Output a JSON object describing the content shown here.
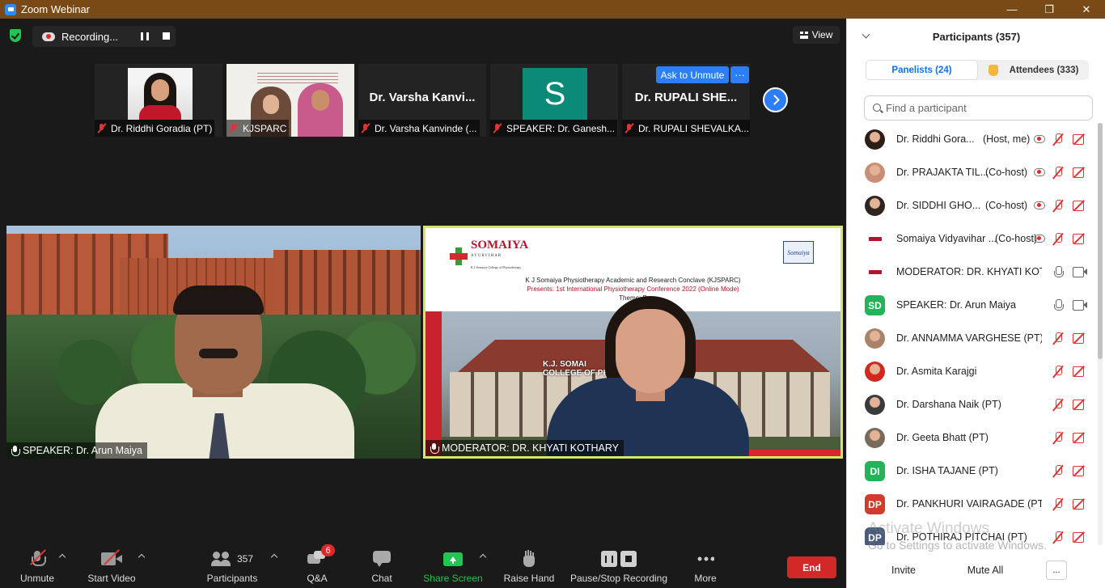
{
  "window": {
    "title": "Zoom Webinar",
    "controls": [
      "—",
      "❐",
      "✕"
    ]
  },
  "top": {
    "recording_label": "Recording...",
    "view_label": "View"
  },
  "thumbnails": [
    {
      "label": "Dr. Riddhi Goradia (PT)",
      "name": "",
      "kind": "photo"
    },
    {
      "label": "KJSPARC",
      "name": "",
      "kind": "slide"
    },
    {
      "label": "Dr. Varsha Kanvinde (...",
      "name": "Dr. Varsha Kanvi...",
      "kind": "name"
    },
    {
      "label": "SPEAKER: Dr. Ganesh...",
      "name": "",
      "avatar_letter": "S",
      "kind": "avatar"
    },
    {
      "label": "Dr. RUPALI SHEVALKA...",
      "name": "Dr. RUPALI SHE...",
      "kind": "name"
    }
  ],
  "ask_to_unmute": "Ask to Unmute",
  "thumb_more": "···",
  "main_videos": {
    "left_label": "SPEAKER: Dr. Arun Maiya",
    "right_label": "MODERATOR: DR. KHYATI KOTHARY"
  },
  "slide": {
    "logo_text": "SOMAIYA",
    "logo_sub": "AYURVIHAR",
    "logo_sub2": "K J Somaiya College of Physiotherapy",
    "trust_logo": "Somaiya",
    "line1": "K J Somaiya Physiotherapy Academic and Research Conclave (KJSPARC)",
    "line2": "Presents: 1st International  Physiotherapy Conference 2022 (Online Mode)",
    "line3": "Theme: B",
    "building_sign": "K.J. SOMAI\nCOLLEGE OF PHYSIO"
  },
  "toolbar": {
    "unmute": "Unmute",
    "start_video": "Start Video",
    "participants_count": "357",
    "participants": "Participants",
    "qa": "Q&A",
    "qa_badge": "6",
    "chat": "Chat",
    "share_screen": "Share Screen",
    "raise_hand": "Raise Hand",
    "pause_stop_recording": "Pause/Stop Recording",
    "more": "More",
    "end": "End"
  },
  "panel": {
    "title": "Participants (357)",
    "tabs": {
      "panelists": "Panelists (24)",
      "attendees": "Attendees (333)"
    },
    "search_placeholder": "Find a participant",
    "participants": [
      {
        "name": "Dr. Riddhi Gora...",
        "role": "(Host, me)",
        "avatar": "photo",
        "color": "#2b1d18",
        "rec": true,
        "mic": "muted",
        "video": "muted"
      },
      {
        "name": "Dr. PRAJAKTA TIL...",
        "role": "(Co-host)",
        "avatar": "photo",
        "color": "#c98f76",
        "rec": true,
        "mic": "muted",
        "video": "muted"
      },
      {
        "name": "Dr. SIDDHI GHO...",
        "role": "(Co-host)",
        "avatar": "photo",
        "color": "#2e2420",
        "rec": true,
        "mic": "muted",
        "video": "muted"
      },
      {
        "name": "Somaiya Vidyavihar ...",
        "role": "(Co-host)",
        "avatar": "logo",
        "color": "#b5122b",
        "rec": true,
        "mic": "muted",
        "video": "muted"
      },
      {
        "name": "MODERATOR: DR. KHYATI KOT...",
        "role": "",
        "avatar": "logo",
        "color": "#b5122b",
        "rec": false,
        "mic": "on",
        "video": "on"
      },
      {
        "name": "SPEAKER: Dr. Arun Maiya",
        "role": "",
        "avatar": "SD",
        "color": "#23b35a",
        "rec": false,
        "mic": "on",
        "video": "on"
      },
      {
        "name": "Dr. ANNAMMA VARGHESE (PT)",
        "role": "",
        "avatar": "photo",
        "color": "#a9826b",
        "rec": false,
        "mic": "muted",
        "video": "muted"
      },
      {
        "name": "Dr. Asmita Karajgi",
        "role": "",
        "avatar": "photo",
        "color": "#d0281f",
        "rec": false,
        "mic": "muted",
        "video": "muted"
      },
      {
        "name": "Dr. Darshana Naik (PT)",
        "role": "",
        "avatar": "photo",
        "color": "#3a3a3a",
        "rec": false,
        "mic": "muted",
        "video": "muted"
      },
      {
        "name": "Dr. Geeta Bhatt (PT)",
        "role": "",
        "avatar": "photo",
        "color": "#7a6a5a",
        "rec": false,
        "mic": "muted",
        "video": "muted"
      },
      {
        "name": "Dr. ISHA TAJANE (PT)",
        "role": "",
        "avatar": "DI",
        "color": "#23b35a",
        "rec": false,
        "mic": "muted",
        "video": "muted"
      },
      {
        "name": "Dr. PANKHURI VAIRAGADE (PT)",
        "role": "",
        "avatar": "DP",
        "color": "#d23b2b",
        "rec": false,
        "mic": "muted",
        "video": "muted"
      },
      {
        "name": "Dr. POTHIRAJ PITCHAI (PT)",
        "role": "",
        "avatar": "DP",
        "color": "#4a5a7a",
        "rec": false,
        "mic": "muted",
        "video": "muted"
      }
    ],
    "footer": {
      "invite": "Invite",
      "mute_all": "Mute All",
      "more": "..."
    }
  },
  "watermark": {
    "line1": "Activate Windows",
    "line2": "Go to Settings to activate Windows."
  }
}
